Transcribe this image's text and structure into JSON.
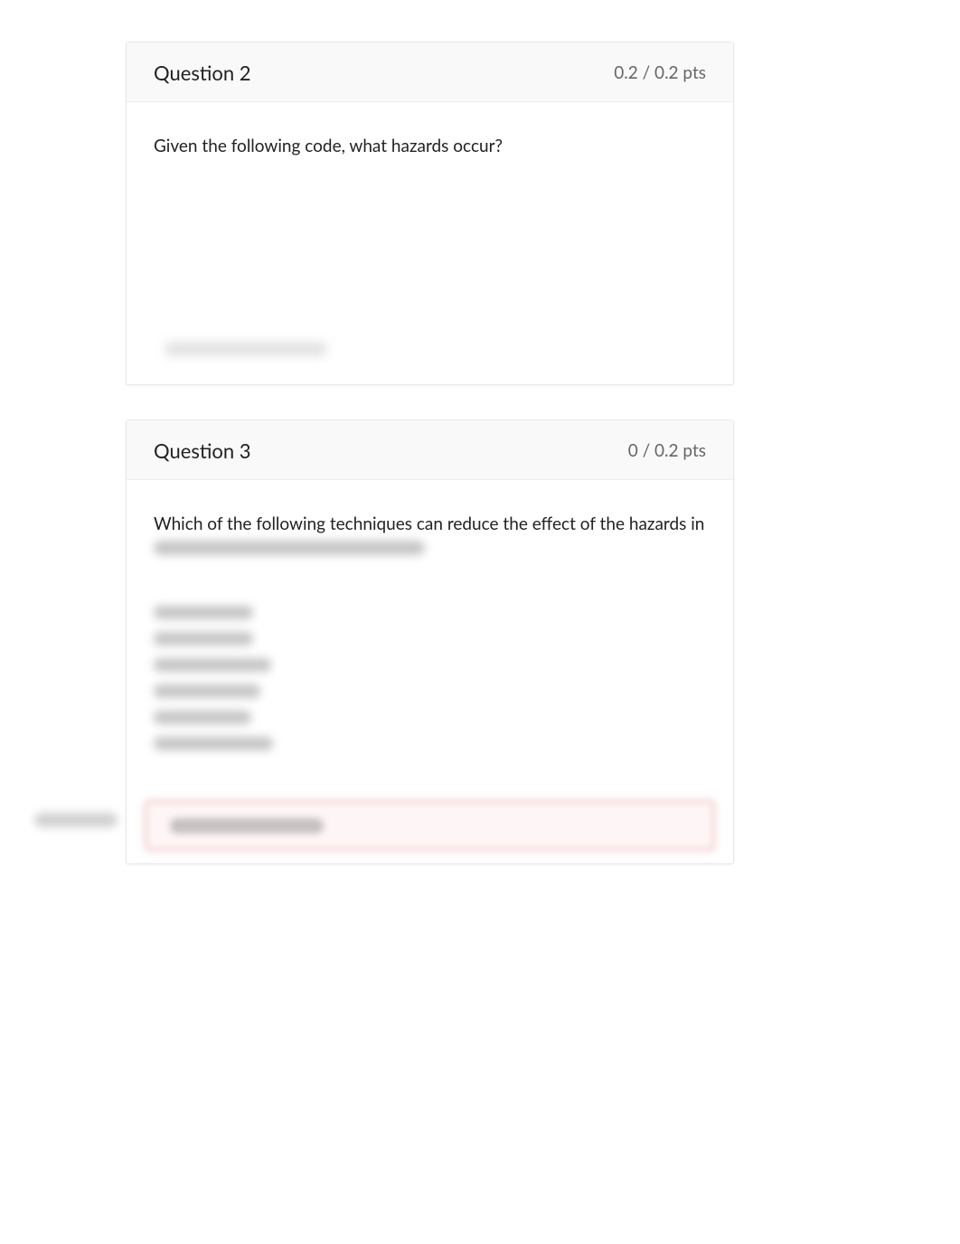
{
  "question2": {
    "title": "Question 2",
    "points": "0.2 / 0.2 pts",
    "prompt": "Given the following code, what hazards occur?"
  },
  "question3": {
    "title": "Question 3",
    "points": "0 / 0.2 pts",
    "prompt": "Which of the following techniques can reduce the effect of the hazards in"
  }
}
